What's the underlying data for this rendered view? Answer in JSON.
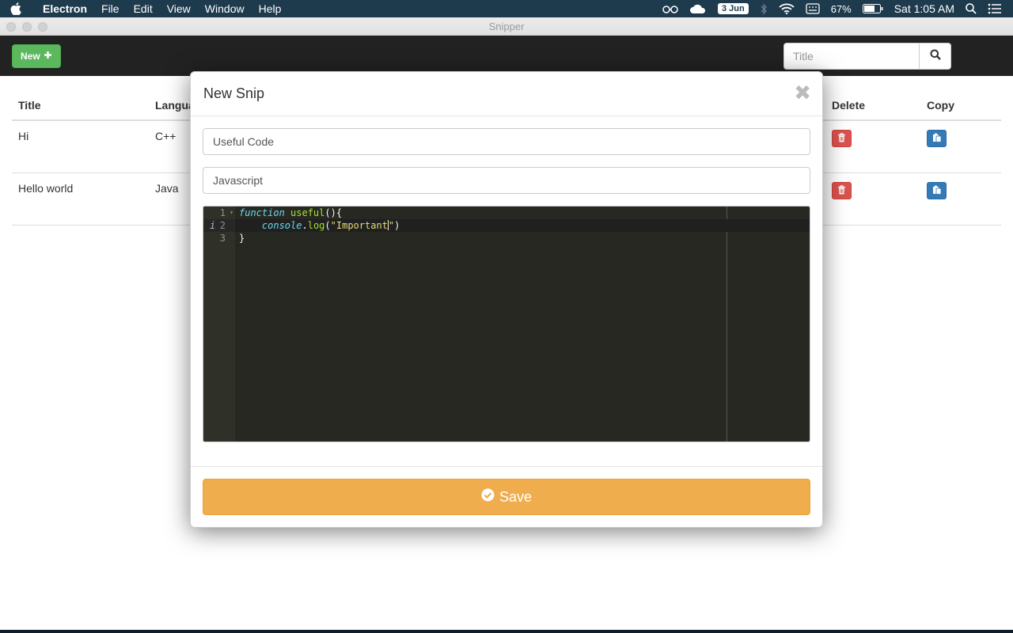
{
  "menubar": {
    "app_name": "Electron",
    "menus": [
      "File",
      "Edit",
      "View",
      "Window",
      "Help"
    ],
    "date_badge": "3 Jun",
    "battery_pct": "67%",
    "clock": "Sat 1:05 AM"
  },
  "window": {
    "title": "Snipper"
  },
  "toolbar": {
    "new_label": "New",
    "search_placeholder": "Title"
  },
  "table": {
    "headers": {
      "title": "Title",
      "language": "Language",
      "delete": "Delete",
      "copy": "Copy"
    },
    "rows": [
      {
        "title": "Hi",
        "language": "C++"
      },
      {
        "title": "Hello world",
        "language": "Java"
      }
    ]
  },
  "modal": {
    "title": "New Snip",
    "close_glyph": "✖",
    "title_value": "Useful Code",
    "language_value": "Javascript",
    "editor": {
      "line_numbers": [
        "1",
        "2",
        "3"
      ],
      "info_marker": "i",
      "line1": {
        "kw": "function",
        "fn": "useful",
        "rest": "(){"
      },
      "line2": {
        "indent": "    ",
        "obj": "console",
        "dot": ".",
        "method": "log",
        "open": "(",
        "str_a": "\"Important",
        "str_b": "\"",
        "close": ")"
      },
      "line3": "}"
    },
    "save_label": "Save"
  },
  "colors": {
    "new_button": "#5cb85c",
    "delete_button": "#d9534f",
    "copy_button": "#337ab7",
    "save_button": "#f0ad4e",
    "editor_bg": "#272822"
  }
}
